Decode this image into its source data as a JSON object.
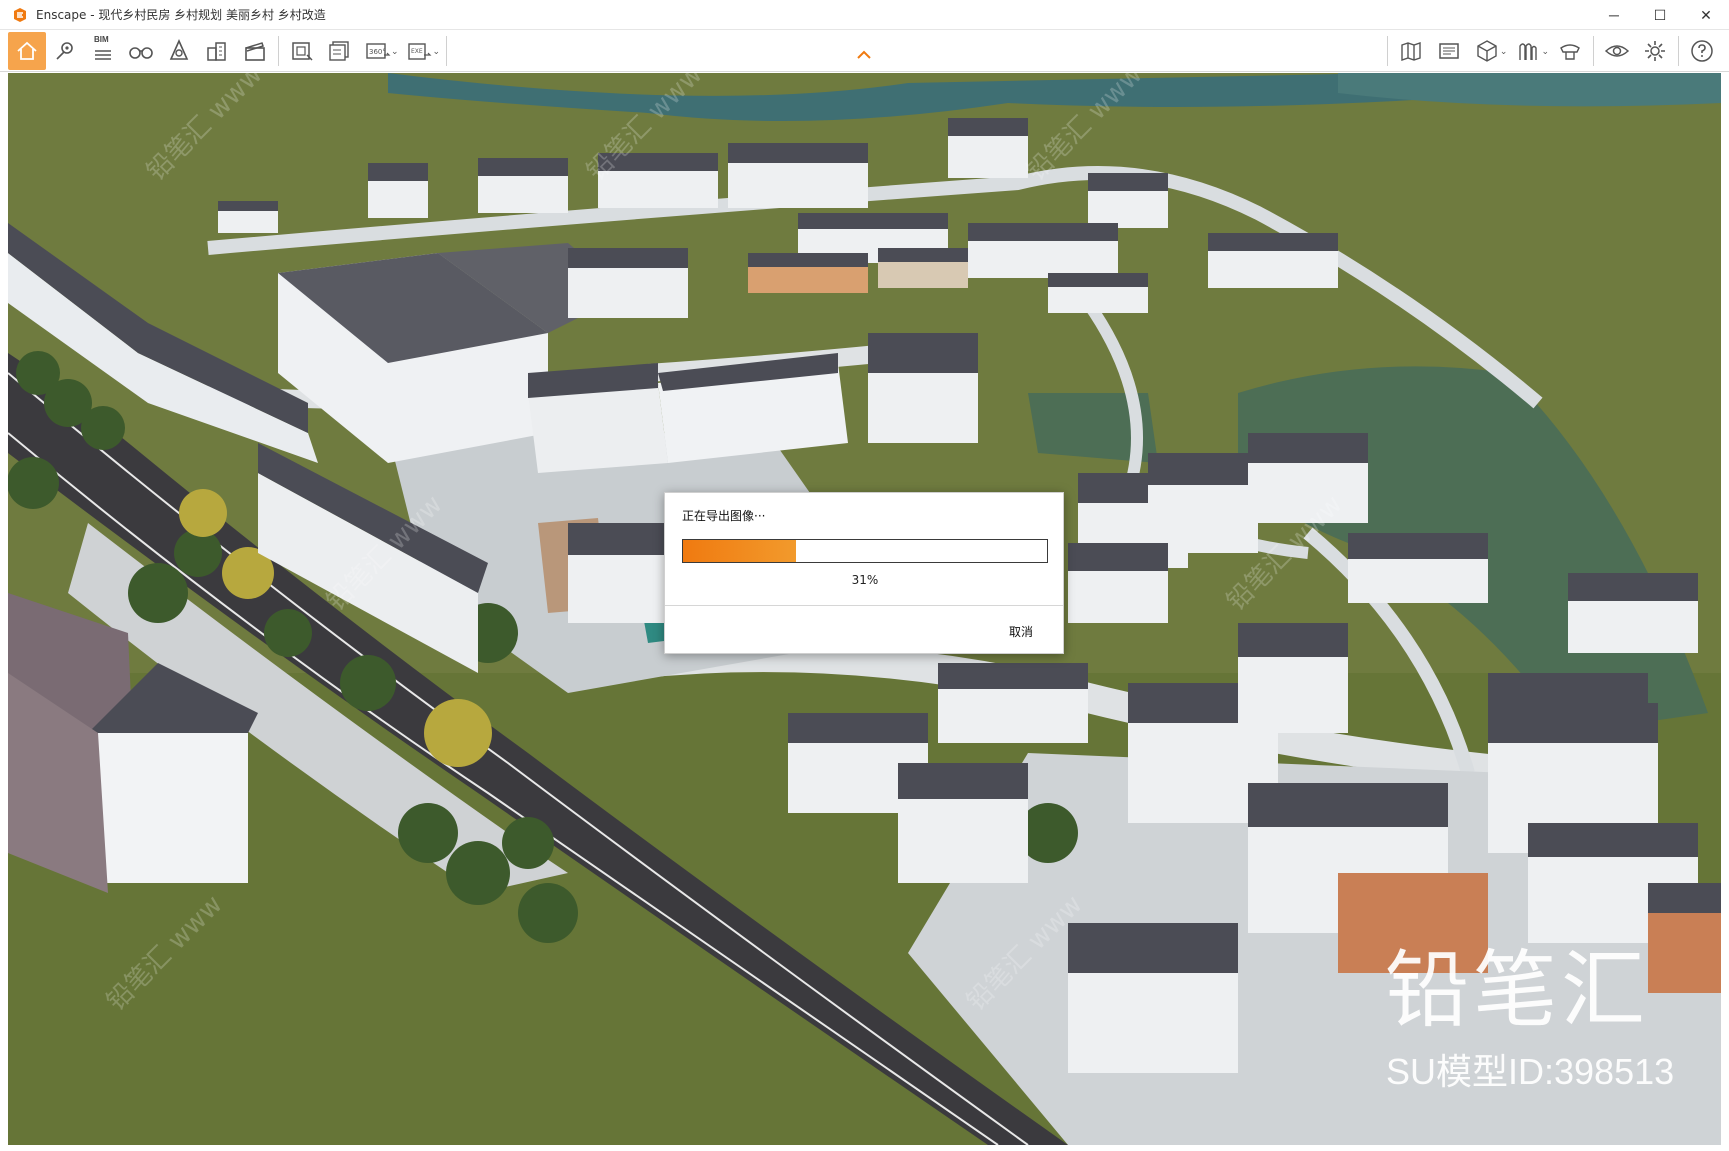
{
  "window": {
    "app_name": "Enscape",
    "title": "Enscape - 现代乡村民房 乡村规划 美丽乡村 乡村改造",
    "controls": {
      "minimize": "─",
      "maximize": "☐",
      "close": "✕"
    }
  },
  "toolbar": {
    "left_icons": [
      "home-icon",
      "map-pin-icon",
      "bim-icon",
      "binoculars-icon",
      "perspective-icon",
      "buildings-icon",
      "clapper-icon",
      "screenshot-icon",
      "batch-render-icon",
      "panorama-360-icon",
      "exe-export-icon"
    ],
    "right_icons": [
      "map-icon",
      "image-gallery-icon",
      "cube-view-icon",
      "asset-library-icon",
      "material-editor-icon",
      "visual-settings-icon",
      "gear-icon",
      "help-icon"
    ],
    "bim_label": "BIM",
    "panorama_label": "360°",
    "exe_label": "EXE"
  },
  "export_dialog": {
    "title": "正在导出图像···",
    "progress_percent": 31,
    "progress_text": "31%",
    "cancel_label": "取消"
  },
  "watermark": {
    "brand": "铅笔汇",
    "model_id": "SU模型ID:398513",
    "diagonal_text": "铅笔汇 www"
  },
  "colors": {
    "accent": "#f07a10",
    "home_button": "#f6a44c"
  }
}
